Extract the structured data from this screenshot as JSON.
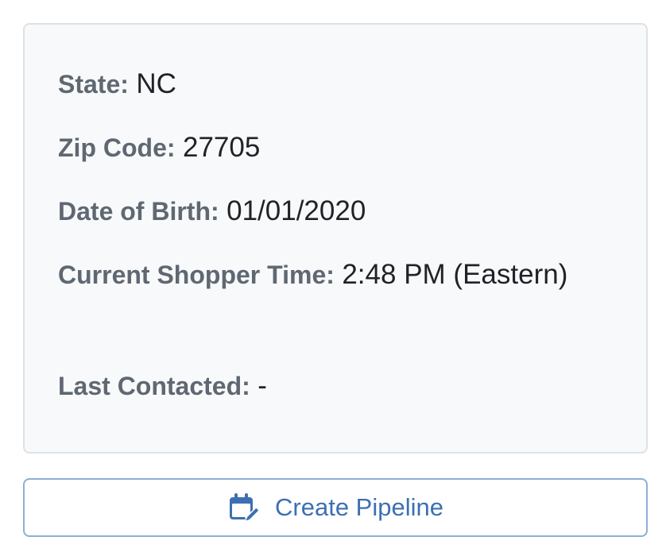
{
  "details": {
    "state": {
      "label": "State:",
      "value": "NC"
    },
    "zip_code": {
      "label": "Zip Code:",
      "value": "27705"
    },
    "date_of_birth": {
      "label": "Date of Birth:",
      "value": "01/01/2020"
    },
    "current_shopper_time": {
      "label": "Current Shopper Time:",
      "value": "2:48 PM (Eastern)"
    },
    "last_contacted": {
      "label": "Last Contacted:",
      "value": "-"
    }
  },
  "actions": {
    "create_pipeline_label": "Create Pipeline",
    "create_pipeline_icon": "calendar-edit-icon"
  },
  "colors": {
    "card_background": "#f8f9fa",
    "card_border": "#dee2e6",
    "label_text": "#5f6872",
    "value_text": "#1f2328",
    "button_accent": "#3d6fb4",
    "button_border": "#8eaed6"
  }
}
